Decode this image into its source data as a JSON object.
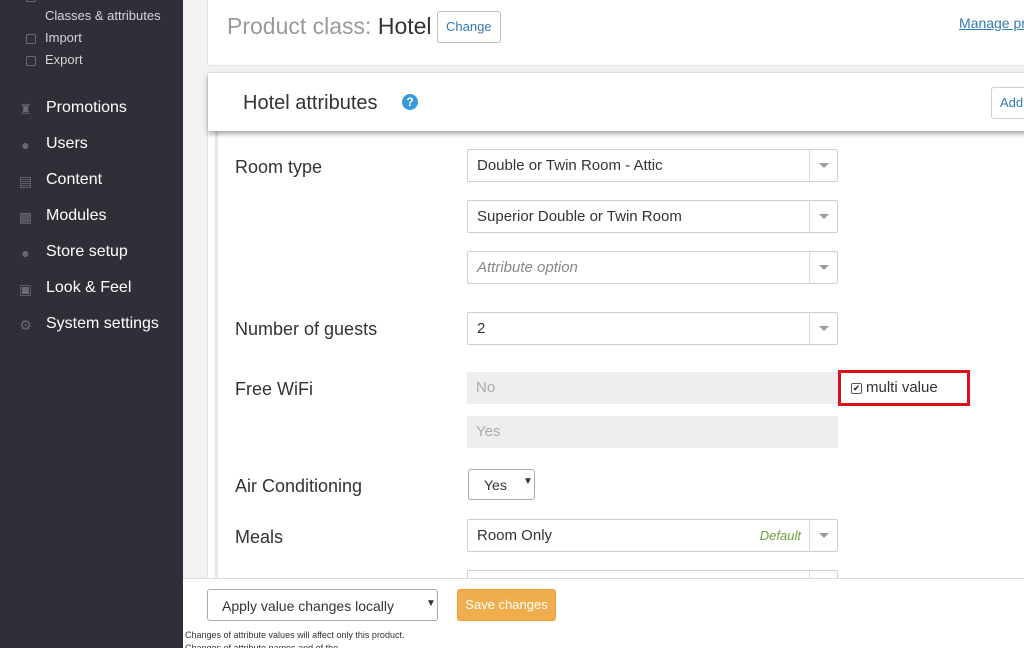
{
  "sidebar": {
    "sub_items": [
      {
        "label": "Classes & attributes",
        "icon": "none"
      },
      {
        "label": "Import",
        "icon": "import-icon"
      },
      {
        "label": "Export",
        "icon": "export-icon"
      }
    ],
    "items": [
      {
        "label": "Promotions",
        "icon": "trophy-icon"
      },
      {
        "label": "Users",
        "icon": "users-icon"
      },
      {
        "label": "Content",
        "icon": "content-icon"
      },
      {
        "label": "Modules",
        "icon": "puzzle-icon"
      },
      {
        "label": "Store setup",
        "icon": "info-icon"
      },
      {
        "label": "Look & Feel",
        "icon": "image-icon"
      },
      {
        "label": "System settings",
        "icon": "gear-icon"
      }
    ]
  },
  "product_class": {
    "label": "Product class: ",
    "value": "Hotel",
    "change_label": "Change",
    "manage_link": "Manage pr"
  },
  "attributes": {
    "title": "Hotel attributes",
    "help_icon": "?",
    "add_label": "Add",
    "room_type": {
      "label": "Room type",
      "options": [
        "Double or Twin Room - Attic",
        "Superior Double or Twin Room"
      ],
      "placeholder": "Attribute option"
    },
    "guests": {
      "label": "Number of guests",
      "value": "2"
    },
    "wifi": {
      "label": "Free WiFi",
      "values": [
        "No",
        "Yes"
      ],
      "multi_label": "multi value",
      "multi_checked": true
    },
    "ac": {
      "label": "Air Conditioning",
      "value": "Yes"
    },
    "meals": {
      "label": "Meals",
      "value": "Room Only",
      "default_label": "Default"
    }
  },
  "footer": {
    "apply_option": "Apply value changes locally",
    "save_label": "Save changes",
    "note": "Changes of attribute values will affect only this product. Changes of attribute names and of the"
  },
  "colors": {
    "sidebar_bg": "#2f2f37",
    "save_button": "#f0ad4e",
    "highlight": "#e0101a",
    "link": "#337ab7"
  }
}
